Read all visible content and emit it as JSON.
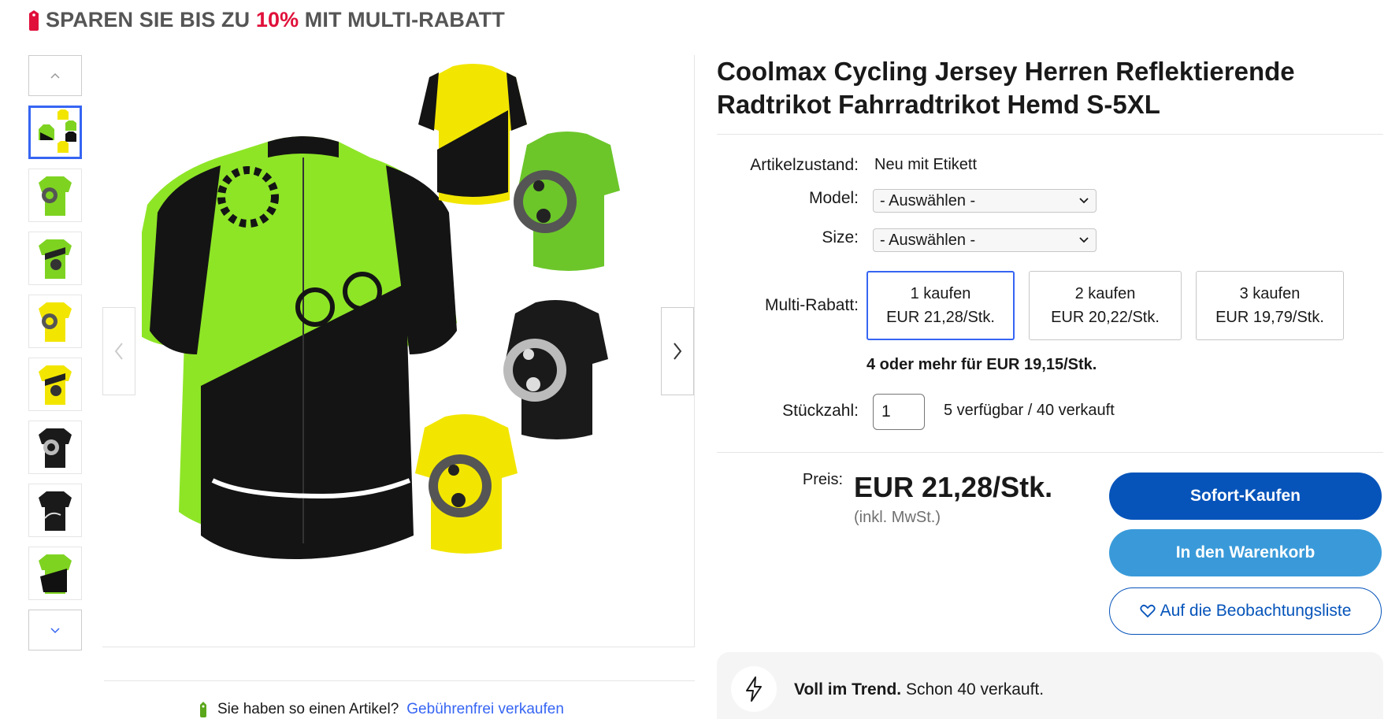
{
  "banner": {
    "prefix": "SPAREN SIE BIS ZU ",
    "percent": "10%",
    "suffix": " MIT MULTI-RABATT"
  },
  "gallery": {
    "thumbnails": [
      {
        "variant": "collage",
        "active": true
      },
      {
        "variant": "green-chain"
      },
      {
        "variant": "green-gear"
      },
      {
        "variant": "yellow-chain"
      },
      {
        "variant": "yellow-gear"
      },
      {
        "variant": "black-chain"
      },
      {
        "variant": "black-rider"
      },
      {
        "variant": "green-rider"
      }
    ]
  },
  "sell": {
    "question": "Sie haben so einen Artikel?",
    "link": "Gebührenfrei verkaufen"
  },
  "product": {
    "title": "Coolmax Cycling Jersey Herren Reflektierende Radtrikot Fahrradtrikot Hemd S-5XL",
    "condition_label": "Artikelzustand:",
    "condition_value": "Neu mit Etikett",
    "model_label": "Model:",
    "model_value": "- Auswählen -",
    "size_label": "Size:",
    "size_value": "- Auswählen -",
    "multi_label": "Multi-Rabatt:",
    "tiers": [
      {
        "qty": "1 kaufen",
        "price": "EUR 21,28/Stk."
      },
      {
        "qty": "2 kaufen",
        "price": "EUR 20,22/Stk."
      },
      {
        "qty": "3 kaufen",
        "price": "EUR 19,79/Stk."
      }
    ],
    "multi_more": "4 oder mehr für EUR 19,15/Stk.",
    "qty_label": "Stückzahl:",
    "qty_value": "1",
    "availability": "5 verfügbar / 40 verkauft",
    "price_label": "Preis:",
    "price": "EUR 21,28/Stk.",
    "tax_note": "(inkl. MwSt.)"
  },
  "actions": {
    "buy_now": "Sofort-Kaufen",
    "add_to_cart": "In den Warenkorb",
    "watchlist": "Auf die Beobachtungsliste"
  },
  "trend": {
    "bold": "Voll im Trend.",
    "rest": " Schon 40 verkauft."
  },
  "colors": {
    "accent_blue": "#3665f3",
    "buy_blue": "#0654ba",
    "cart_blue": "#3a9ad9",
    "sale_red": "#e0103a",
    "jersey_green": "#7ed321",
    "jersey_yellow": "#f2e600"
  }
}
